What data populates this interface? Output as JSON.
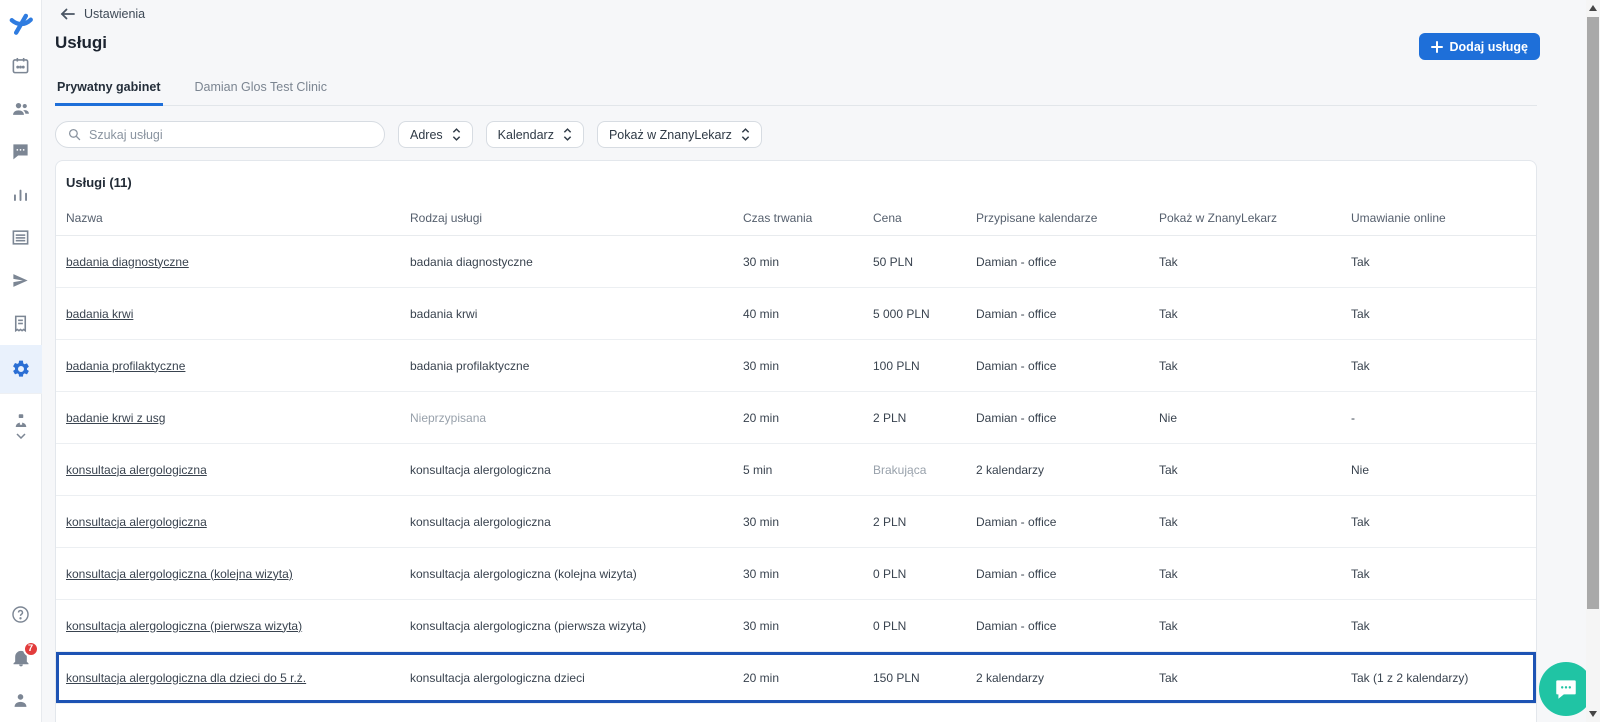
{
  "colors": {
    "accent": "#1e6fd9",
    "highlight_border": "#1d53b4",
    "chat_teal": "#20c4a4",
    "badge_red": "#e23c3c"
  },
  "sidebar": {
    "icons": [
      "docplanner-logo",
      "calendar",
      "patients",
      "messages",
      "statistics",
      "services-list",
      "campaigns",
      "billing",
      "settings",
      "team",
      "help",
      "notifications",
      "profile"
    ],
    "active_item": "settings",
    "notification_count": "7"
  },
  "header": {
    "back_label": "Ustawienia",
    "title": "Usługi",
    "add_button_label": "Dodaj usługę"
  },
  "tabs": [
    {
      "label": "Prywatny gabinet",
      "active": true
    },
    {
      "label": "Damian Glos Test Clinic",
      "active": false
    }
  ],
  "filters": {
    "search_placeholder": "Szukaj usługi",
    "dropdowns": [
      "Adres",
      "Kalendarz",
      "Pokaż w ZnanyLekarz"
    ]
  },
  "table": {
    "title": "Usługi (11)",
    "columns": [
      "Nazwa",
      "Rodzaj usługi",
      "Czas trwania",
      "Cena",
      "Przypisane kalendarze",
      "Pokaż w ZnanyLekarz",
      "Umawianie online"
    ],
    "rows": [
      {
        "name": "badania diagnostyczne",
        "type": "badania diagnostyczne",
        "duration": "30 min",
        "price": "50 PLN",
        "calendars": "Damian - office",
        "show": "Tak",
        "online": "Tak"
      },
      {
        "name": "badania krwi",
        "type": "badania krwi",
        "duration": "40 min",
        "price": "5 000 PLN",
        "calendars": "Damian - office",
        "show": "Tak",
        "online": "Tak"
      },
      {
        "name": "badania profilaktyczne",
        "type": "badania profilaktyczne",
        "duration": "30 min",
        "price": "100 PLN",
        "calendars": "Damian - office",
        "show": "Tak",
        "online": "Tak"
      },
      {
        "name": "badanie krwi z usg",
        "type": "Nieprzypisana",
        "type_muted": true,
        "duration": "20 min",
        "price": "2 PLN",
        "calendars": "Damian - office",
        "show": "Nie",
        "online": "-"
      },
      {
        "name": "konsultacja alergologiczna",
        "type": "konsultacja alergologiczna",
        "duration": "5 min",
        "price": "Brakująca",
        "price_muted": true,
        "calendars": "2 kalendarzy",
        "show": "Tak",
        "online": "Nie"
      },
      {
        "name": "konsultacja alergologiczna",
        "type": "konsultacja alergologiczna",
        "duration": "30 min",
        "price": "2 PLN",
        "calendars": "Damian - office",
        "show": "Tak",
        "online": "Tak"
      },
      {
        "name": "konsultacja alergologiczna (kolejna wizyta)",
        "type": "konsultacja alergologiczna (kolejna wizyta)",
        "duration": "30 min",
        "price": "0 PLN",
        "calendars": "Damian - office",
        "show": "Tak",
        "online": "Tak"
      },
      {
        "name": "konsultacja alergologiczna (pierwsza wizyta)",
        "type": "konsultacja alergologiczna (pierwsza wizyta)",
        "duration": "30 min",
        "price": "0 PLN",
        "calendars": "Damian - office",
        "show": "Tak",
        "online": "Tak"
      },
      {
        "name": "konsultacja alergologiczna dla dzieci do 5 r.ż.",
        "type": "konsultacja alergologiczna dzieci",
        "duration": "20 min",
        "price": "150 PLN",
        "calendars": "2 kalendarzy",
        "show": "Tak",
        "online": "Tak (1 z 2 kalendarzy)",
        "highlighted": true
      }
    ]
  }
}
